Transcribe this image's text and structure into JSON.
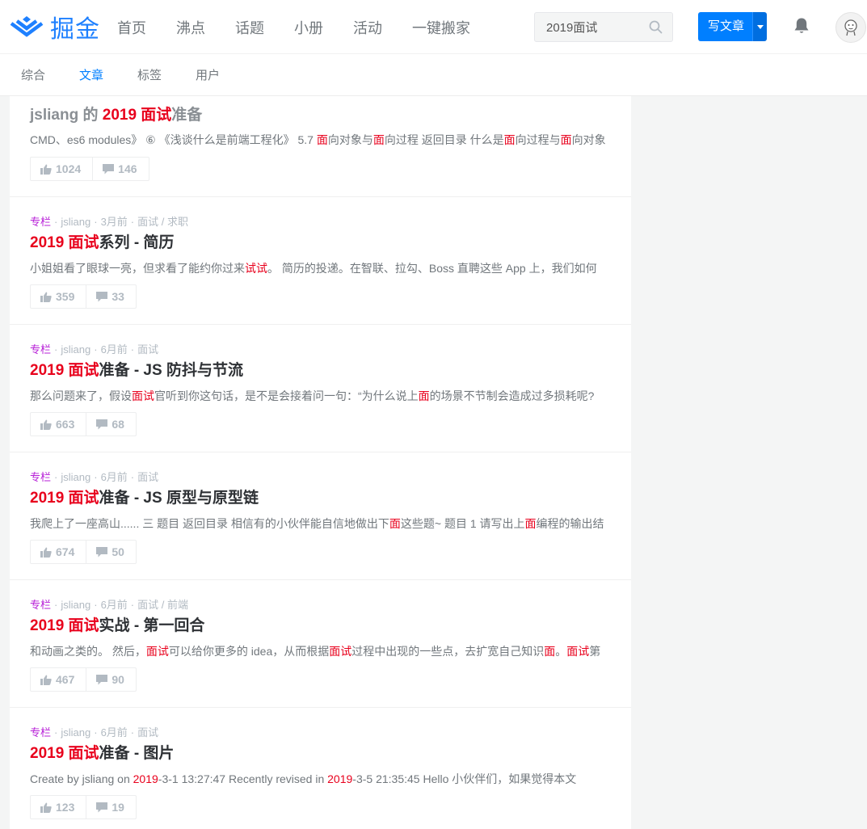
{
  "logo": {
    "text": "掘金"
  },
  "nav": [
    "首页",
    "沸点",
    "话题",
    "小册",
    "活动",
    "一键搬家"
  ],
  "search": {
    "value": "2019面试"
  },
  "write": {
    "label": "写文章"
  },
  "subnav": [
    "综合",
    "文章",
    "标签",
    "用户"
  ],
  "colors": {
    "accent": "#007fff",
    "highlight": "#e8001c",
    "column": "#b71ed7"
  },
  "articles": [
    {
      "meta": {
        "column": "",
        "author": "",
        "time": "",
        "tags": ""
      },
      "title": [
        {
          "t": "jsliang 的 ",
          "h": false
        },
        {
          "t": "2019 面试",
          "h": true
        },
        {
          "t": "准备",
          "h": false
        }
      ],
      "abstract": [
        {
          "t": "CMD、es6 modules》 ⑥ 《浅谈什么是前端工程化》 5.7 ",
          "h": false
        },
        {
          "t": "面",
          "h": true
        },
        {
          "t": "向对象与",
          "h": false
        },
        {
          "t": "面",
          "h": true
        },
        {
          "t": "向过程 返回目录 什么是",
          "h": false
        },
        {
          "t": "面",
          "h": true
        },
        {
          "t": "向过程与",
          "h": false
        },
        {
          "t": "面",
          "h": true
        },
        {
          "t": "向对象",
          "h": false
        }
      ],
      "likes": "1024",
      "comments": "146"
    },
    {
      "meta": {
        "column": "专栏",
        "author": "jsliang",
        "time": "3月前",
        "tags": "面试 / 求职"
      },
      "title": [
        {
          "t": "2019 面试",
          "h": true
        },
        {
          "t": "系列 - 简历",
          "h": false
        }
      ],
      "abstract": [
        {
          "t": "小姐姐看了眼球一亮，但求看了能约你过来",
          "h": false
        },
        {
          "t": "试试",
          "h": true
        },
        {
          "t": "。 简历的投递。在智联、拉勾、Boss 直聘这些 App 上，我们如何",
          "h": false
        }
      ],
      "likes": "359",
      "comments": "33"
    },
    {
      "meta": {
        "column": "专栏",
        "author": "jsliang",
        "time": "6月前",
        "tags": "面试"
      },
      "title": [
        {
          "t": "2019 面试",
          "h": true
        },
        {
          "t": "准备 - JS 防抖与节流",
          "h": false
        }
      ],
      "abstract": [
        {
          "t": "那么问题来了，假设",
          "h": false
        },
        {
          "t": "面试",
          "h": true
        },
        {
          "t": "官听到你这句话，是不是会接着问一句：“为什么说上",
          "h": false
        },
        {
          "t": "面",
          "h": true
        },
        {
          "t": "的场景不节制会造成过多损耗呢?",
          "h": false
        }
      ],
      "likes": "663",
      "comments": "68"
    },
    {
      "meta": {
        "column": "专栏",
        "author": "jsliang",
        "time": "6月前",
        "tags": "面试"
      },
      "title": [
        {
          "t": "2019 面试",
          "h": true
        },
        {
          "t": "准备 - JS 原型与原型链",
          "h": false
        }
      ],
      "abstract": [
        {
          "t": "我爬上了一座高山...... 三 题目 返回目录 相信有的小伙伴能自信地做出下",
          "h": false
        },
        {
          "t": "面",
          "h": true
        },
        {
          "t": "这些题~ 题目 1 请写出上",
          "h": false
        },
        {
          "t": "面",
          "h": true
        },
        {
          "t": "编程的输出结",
          "h": false
        }
      ],
      "likes": "674",
      "comments": "50"
    },
    {
      "meta": {
        "column": "专栏",
        "author": "jsliang",
        "time": "6月前",
        "tags": "面试 / 前端"
      },
      "title": [
        {
          "t": "2019 面试",
          "h": true
        },
        {
          "t": "实战 - 第一回合",
          "h": false
        }
      ],
      "abstract": [
        {
          "t": "和动画之类的。 然后，",
          "h": false
        },
        {
          "t": "面试",
          "h": true
        },
        {
          "t": "可以给你更多的 idea，从而根据",
          "h": false
        },
        {
          "t": "面试",
          "h": true
        },
        {
          "t": "过程中出现的一些点，去扩宽自己知识",
          "h": false
        },
        {
          "t": "面",
          "h": true
        },
        {
          "t": "。",
          "h": false
        },
        {
          "t": "面试",
          "h": true
        },
        {
          "t": "第",
          "h": false
        }
      ],
      "likes": "467",
      "comments": "90"
    },
    {
      "meta": {
        "column": "专栏",
        "author": "jsliang",
        "time": "6月前",
        "tags": "面试"
      },
      "title": [
        {
          "t": "2019 面试",
          "h": true
        },
        {
          "t": "准备 - 图片",
          "h": false
        }
      ],
      "abstract": [
        {
          "t": "Create by jsliang on ",
          "h": false
        },
        {
          "t": "2019",
          "h": true
        },
        {
          "t": "-3-1 13:27:47 Recently revised in ",
          "h": false
        },
        {
          "t": "2019",
          "h": true
        },
        {
          "t": "-3-5 21:35:45 Hello 小伙伴们，如果觉得本文",
          "h": false
        }
      ],
      "likes": "123",
      "comments": "19"
    }
  ]
}
